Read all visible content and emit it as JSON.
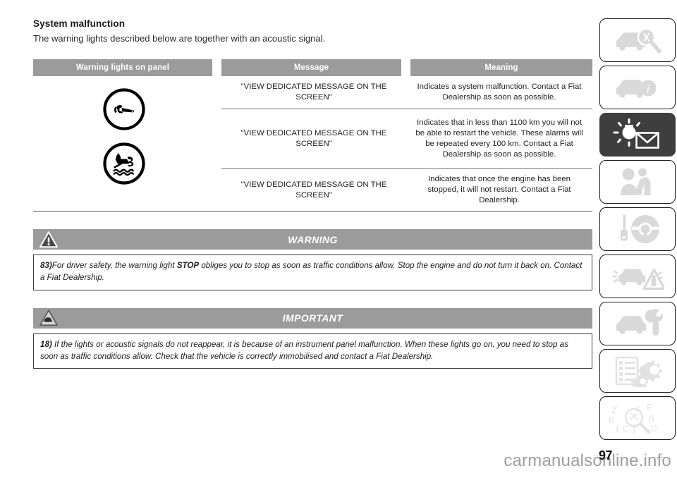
{
  "section": {
    "title": "System malfunction",
    "intro": "The warning lights described below are together with an acoustic signal."
  },
  "table": {
    "headers": {
      "col1": "Warning lights on panel",
      "col2": "Message",
      "col3": "Meaning"
    },
    "icons": [
      {
        "name": "wrench-warning-light",
        "label": "Wrench / service warning light"
      },
      {
        "name": "water-in-fuel-filter-warning-light",
        "label": "Water in fuel filter warning light"
      }
    ],
    "rows": [
      {
        "message": "\"VIEW DEDICATED MESSAGE ON THE SCREEN\"",
        "meaning": "Indicates a system malfunction. Contact a Fiat Dealership as soon as possible."
      },
      {
        "message": "\"VIEW DEDICATED MESSAGE ON THE SCREEN\"",
        "meaning": "Indicates that in less than 1100 km you will not be able to restart the vehicle. These alarms will be repeated every 100 km. Contact a Fiat Dealership as soon as possible."
      },
      {
        "message": "\"VIEW DEDICATED MESSAGE ON THE SCREEN\"",
        "meaning": "Indicates that once the engine has been stopped, it will not restart. Contact a Fiat Dealership."
      }
    ]
  },
  "warning": {
    "banner_label": "WARNING",
    "icon_name": "warning-triangle-icon",
    "note_number": "83)",
    "note_text_1": "For driver safety, the warning light ",
    "note_strong": "STOP",
    "note_text_2": " obliges you to stop as soon as traffic conditions allow. Stop the engine and do not turn it back on. Contact a Fiat Dealership."
  },
  "important": {
    "banner_label": "IMPORTANT",
    "icon_name": "important-car-triangle-icon",
    "note_number": "18)",
    "note_text": "If the lights or acoustic signals do not reappear, it is because of an instrument panel malfunction. When these lights go on, you need to stop as soon as traffic conditions allow. Check that the vehicle is correctly immobilised and contact a Fiat Dealership."
  },
  "sidebar": {
    "items": [
      {
        "name": "car-inspection-icon",
        "label": "Dashboard and controls",
        "active": false
      },
      {
        "name": "car-info-icon",
        "label": "Getting to know your vehicle",
        "active": false
      },
      {
        "name": "warning-light-message-icon",
        "label": "Warning lights and messages",
        "active": true
      },
      {
        "name": "airbag-seatbelt-icon",
        "label": "Safety",
        "active": false
      },
      {
        "name": "key-steering-wheel-icon",
        "label": "Starting and driving",
        "active": false
      },
      {
        "name": "breakdown-warning-triangle-icon",
        "label": "In an emergency",
        "active": false
      },
      {
        "name": "car-wrench-icon",
        "label": "Maintenance and care",
        "active": false
      },
      {
        "name": "specifications-gears-icon",
        "label": "Technical specifications",
        "active": false
      },
      {
        "name": "alphabetical-index-icon",
        "label": "Alphabetical index",
        "active": false
      }
    ]
  },
  "footer": {
    "page_number": "97",
    "watermark": "carmanualsonline.info"
  },
  "colors": {
    "header_gray": "#9b9b9b",
    "active_sidebar": "#3e3e3e",
    "sidebar_icon_gray": "#d9d9d9",
    "text": "#222222"
  }
}
